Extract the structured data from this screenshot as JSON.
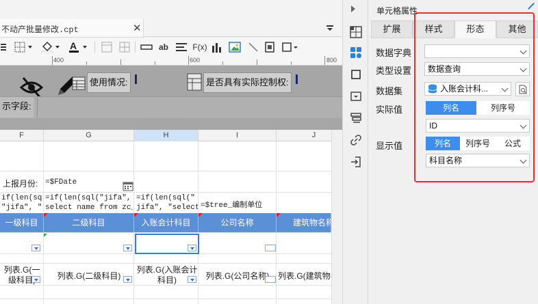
{
  "editor": {
    "file_tab": "不动产批量修改.cpt",
    "ruler_labels": [
      "400",
      "600",
      "800"
    ],
    "params": {
      "usage_label": "使用情况:",
      "control_label": "是否具有实际控制权:",
      "display_field_label": "示字段:"
    },
    "columns": [
      "F",
      "G",
      "H",
      "I",
      "J"
    ],
    "rows": {
      "report_month_label": "上报月份:",
      "report_month_value": "=$FDate",
      "formula_f": "if(len(sq\n\"jifa\", \"",
      "formula_g": "=if(len(sql(\"jifa\", \"\nselect name from zc_",
      "formula_h": "=if(len(sql(\"\njifa\", \"select",
      "formula_i": "=$tree_编制单位",
      "headers": [
        "一级科目",
        "二级科目",
        "入账会计科目",
        "公司名称",
        "建筑物名称"
      ],
      "values": [
        "列表.G(一级科目)",
        "列表.G(二级科目)",
        "列表.G(入账会计科目)",
        "列表.G(公司名称)",
        "列表.G(建筑物名称)"
      ]
    }
  },
  "panel": {
    "title": "单元格属性",
    "tabs": [
      "扩展",
      "样式",
      "形态",
      "其他"
    ],
    "active_tab": "形态",
    "fields": {
      "data_dict_label": "数据字典",
      "data_dict_value": "",
      "type_label": "类型设置",
      "type_value": "数据查询",
      "dataset_label": "数据集",
      "dataset_value": "入账会计科...",
      "actual_label": "实际值",
      "actual_seg": [
        "列名",
        "列序号"
      ],
      "actual_value": "ID",
      "display_label": "显示值",
      "display_seg": [
        "列名",
        "列序号",
        "公式"
      ],
      "display_value": "科目名称"
    },
    "accent_color": "#3e8ded",
    "highlight_color": "#e8312a"
  },
  "sidebar_icons": [
    "cell-attribute-icon",
    "widget-icon",
    "frame-icon",
    "dropdown-icon",
    "stack-icon",
    "link-icon",
    "import-icon"
  ]
}
